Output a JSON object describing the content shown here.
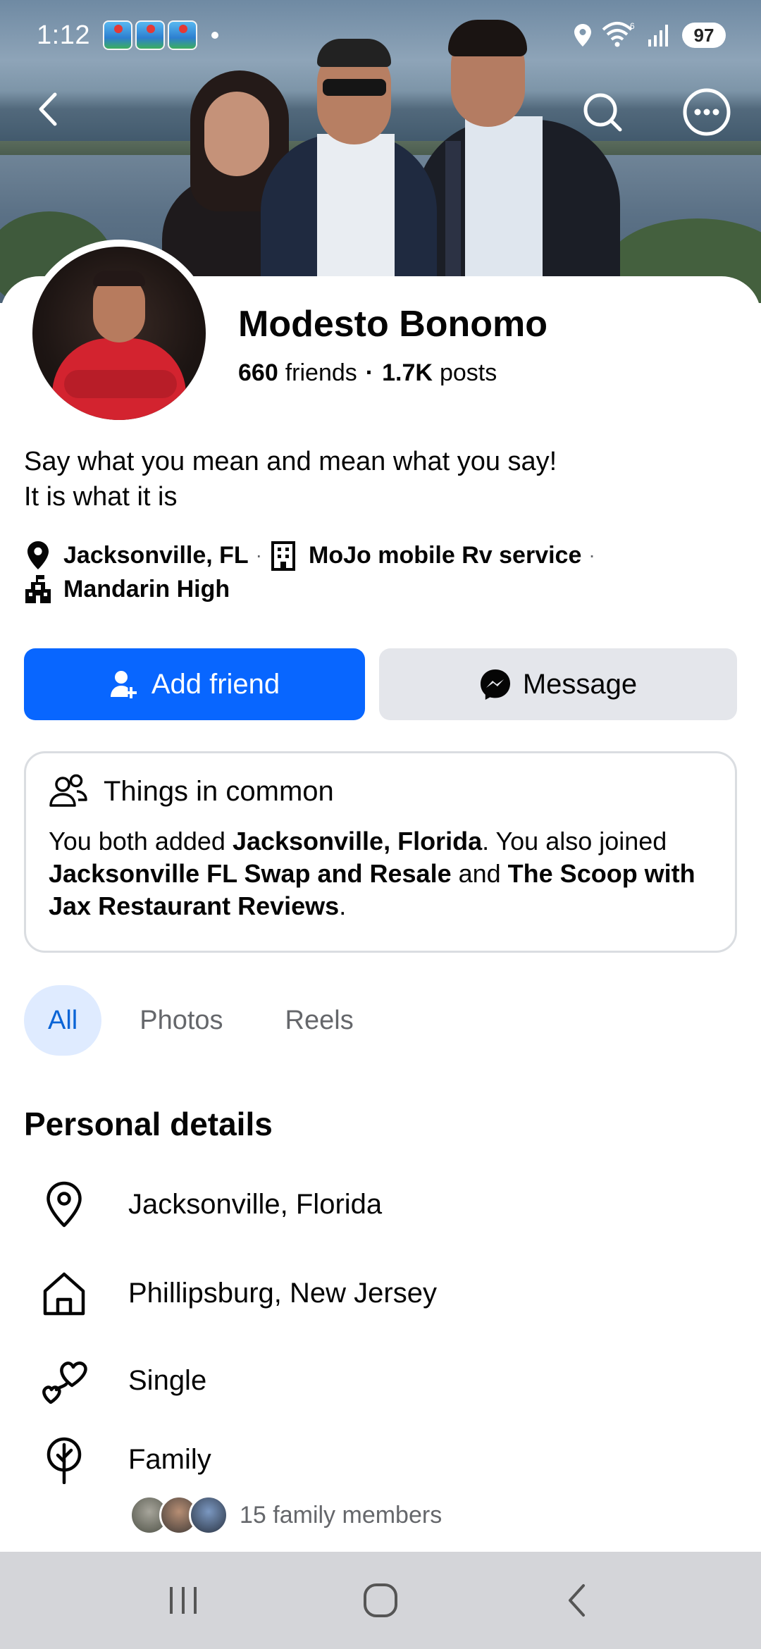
{
  "status_bar": {
    "time": "1:12",
    "app_icons": [
      "GPS",
      "GPS",
      "GPS"
    ],
    "battery": "97"
  },
  "profile": {
    "name": "Modesto Bonomo",
    "friends_count": "660",
    "friends_label": "friends",
    "separator": "·",
    "posts_count": "1.7K",
    "posts_label": "posts",
    "bio_line1": "Say what you mean and mean what you say!",
    "bio_line2": "It is what it is",
    "location": "Jacksonville, FL",
    "work": "MoJo mobile Rv service",
    "school": "Mandarin High"
  },
  "actions": {
    "add_friend_label": "Add friend",
    "message_label": "Message"
  },
  "common": {
    "title": "Things in common",
    "text_1": "You both added ",
    "bold_1": "Jacksonville, Florida",
    "text_2": ". You also joined ",
    "bold_2": "Jacksonville FL Swap and Resale",
    "text_3": " and ",
    "bold_3": "The Scoop with Jax Restaurant Reviews",
    "text_4": "."
  },
  "tabs": [
    {
      "label": "All",
      "active": true
    },
    {
      "label": "Photos",
      "active": false
    },
    {
      "label": "Reels",
      "active": false
    }
  ],
  "personal_details": {
    "title": "Personal details",
    "current_city": "Jacksonville, Florida",
    "hometown": "Phillipsburg, New Jersey",
    "relationship": "Single",
    "family_label": "Family",
    "family_members": "15 family members"
  },
  "icons": {
    "back": "back-arrow-icon",
    "search": "search-icon",
    "more": "more-icon",
    "location": "location-pin-icon",
    "work": "building-icon",
    "school": "school-icon",
    "add_friend": "add-friend-icon",
    "messenger": "messenger-icon",
    "people": "people-icon",
    "home": "home-icon",
    "hearts": "hearts-icon",
    "family": "family-tree-icon"
  },
  "colors": {
    "accent": "#0866ff",
    "secondary_button": "#e4e6eb",
    "active_tab_bg": "#dfebff",
    "active_tab_text": "#0a64d6",
    "muted_text": "#65676b"
  }
}
